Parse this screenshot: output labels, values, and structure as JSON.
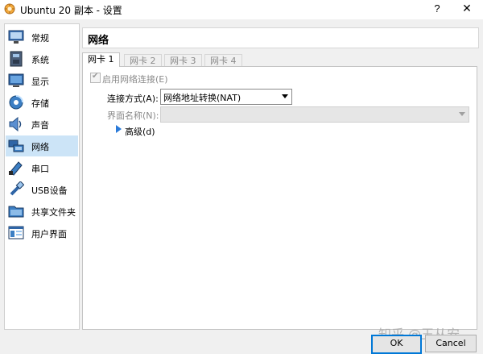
{
  "window": {
    "title": "Ubuntu 20 副本 - 设置",
    "help_label": "?",
    "close_label": "✕"
  },
  "sidebar": {
    "items": [
      {
        "label": "常规",
        "icon": "general-monitor-icon"
      },
      {
        "label": "系统",
        "icon": "system-chip-icon"
      },
      {
        "label": "显示",
        "icon": "display-monitor-icon"
      },
      {
        "label": "存储",
        "icon": "storage-disk-icon"
      },
      {
        "label": "声音",
        "icon": "speaker-icon"
      },
      {
        "label": "网络",
        "icon": "network-icon",
        "selected": true
      },
      {
        "label": "串口",
        "icon": "serial-port-icon"
      },
      {
        "label": "USB设备",
        "icon": "usb-icon"
      },
      {
        "label": "共享文件夹",
        "icon": "shared-folder-icon"
      },
      {
        "label": "用户界面",
        "icon": "user-interface-icon"
      }
    ]
  },
  "main": {
    "title": "网络",
    "tabs": [
      {
        "label": "网卡 1",
        "active": true
      },
      {
        "label": "网卡 2"
      },
      {
        "label": "网卡 3"
      },
      {
        "label": "网卡 4"
      }
    ],
    "enable_adapter": {
      "label": "启用网络连接(E)",
      "checked": true,
      "disabled": true
    },
    "attached_to": {
      "label": "连接方式(A):",
      "value": "网络地址转换(NAT)"
    },
    "name": {
      "label": "界面名称(N):",
      "value": ""
    },
    "advanced_label": "高级(d)"
  },
  "footer": {
    "watermark": "知乎 @王从安",
    "ok_label": "OK",
    "cancel_label": "Cancel"
  },
  "colors": {
    "selection": "#cce4f7",
    "accent": "#0078d7",
    "advanced_arrow": "#2a7ad9"
  }
}
